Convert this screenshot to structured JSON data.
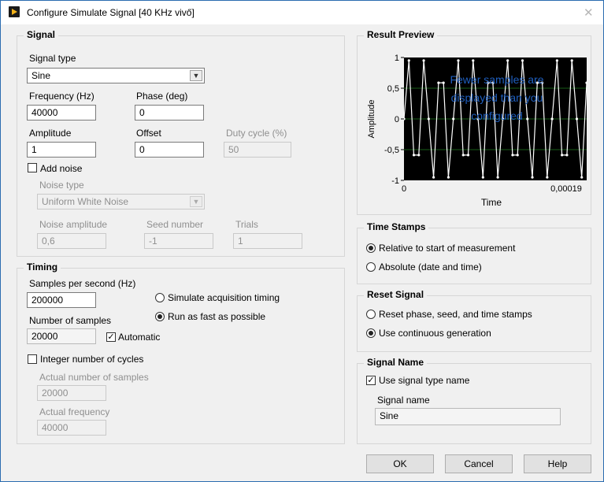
{
  "window": {
    "title": "Configure Simulate Signal [40 KHz vivő]",
    "close_glyph": "✕"
  },
  "signal": {
    "group_title": "Signal",
    "signal_type_label": "Signal type",
    "signal_type_value": "Sine",
    "frequency_label": "Frequency (Hz)",
    "frequency_value": "40000",
    "phase_label": "Phase (deg)",
    "phase_value": "0",
    "amplitude_label": "Amplitude",
    "amplitude_value": "1",
    "offset_label": "Offset",
    "offset_value": "0",
    "duty_label": "Duty cycle (%)",
    "duty_value": "50",
    "add_noise_label": "Add noise",
    "add_noise_checked": false,
    "noise_type_label": "Noise type",
    "noise_type_value": "Uniform White Noise",
    "noise_amplitude_label": "Noise amplitude",
    "noise_amplitude_value": "0,6",
    "seed_label": "Seed number",
    "seed_value": "-1",
    "trials_label": "Trials",
    "trials_value": "1"
  },
  "timing": {
    "group_title": "Timing",
    "sps_label": "Samples per second (Hz)",
    "sps_value": "200000",
    "num_samples_label": "Number of samples",
    "num_samples_value": "20000",
    "automatic_label": "Automatic",
    "automatic_checked": true,
    "simulate_label": "Simulate acquisition timing",
    "run_fast_label": "Run as fast as possible",
    "selected_mode": "run_fast",
    "integer_cycles_label": "Integer number of cycles",
    "integer_cycles_checked": false,
    "actual_samples_label": "Actual number of samples",
    "actual_samples_value": "20000",
    "actual_freq_label": "Actual frequency",
    "actual_freq_value": "40000"
  },
  "preview": {
    "group_title": "Result Preview",
    "overlay_text": "Fewer samples are displayed than you configured",
    "overlay_lines": [
      "Fewer samples are",
      "displayed than you",
      "configured"
    ]
  },
  "chart_data": {
    "type": "line",
    "title": "",
    "xlabel": "Time",
    "ylabel": "Amplitude",
    "xlim": [
      0,
      0.00019
    ],
    "ylim": [
      -1,
      1
    ],
    "y_ticks": [
      "1",
      "0,5",
      "0",
      "-0,5",
      "-1"
    ],
    "x_ticks": [
      "0",
      "0,00019"
    ],
    "grid": true,
    "background": "#000000",
    "line_color": "#ffffff",
    "grid_color": "#1f7a1f",
    "series": [
      {
        "values": [
          0,
          0.951,
          -0.588,
          -0.588,
          0.951,
          0,
          -0.951,
          0.588,
          0.588,
          -0.951,
          0,
          0.951,
          -0.588,
          -0.588,
          0.951,
          0,
          -0.951,
          0.588,
          0.588,
          -0.951,
          0,
          0.951,
          -0.588,
          -0.588,
          0.951,
          0,
          -0.951,
          0.588,
          0.588,
          -0.951,
          0,
          0.951,
          -0.588,
          -0.588,
          0.951,
          0,
          -0.951,
          0.588
        ]
      }
    ]
  },
  "timestamps": {
    "group_title": "Time Stamps",
    "relative_label": "Relative to start of measurement",
    "absolute_label": "Absolute (date and time)",
    "selected": "relative"
  },
  "reset": {
    "group_title": "Reset Signal",
    "reset_label": "Reset phase, seed, and time stamps",
    "continuous_label": "Use continuous generation",
    "selected": "continuous"
  },
  "signal_name": {
    "group_title": "Signal Name",
    "use_type_name_label": "Use signal type name",
    "use_type_name_checked": true,
    "name_label": "Signal name",
    "name_value": "Sine"
  },
  "buttons": {
    "ok": "OK",
    "cancel": "Cancel",
    "help": "Help"
  },
  "colors": {
    "window_border": "#2b6cb0",
    "dialog_bg": "#f0f0f0",
    "overlay_text": "#1f5fbf",
    "app_icon": "#f2b21a"
  }
}
